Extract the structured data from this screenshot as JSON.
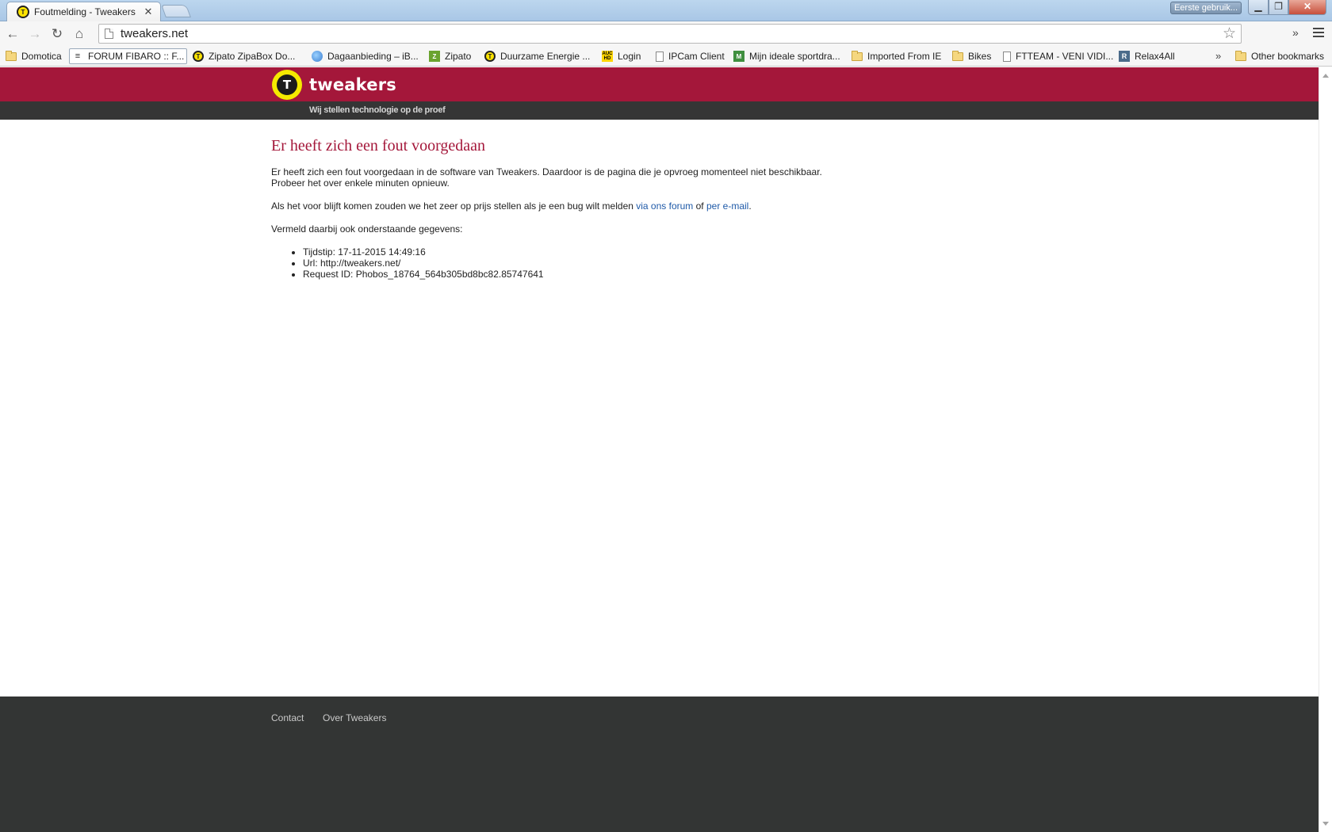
{
  "browser": {
    "tab_title": "Foutmelding - Tweakers",
    "tab_close_glyph": "✕",
    "profile_button": "Eerste gebruik...",
    "window_min": "▁",
    "window_max": "❐",
    "window_close": "✕",
    "url": "tweakers.net",
    "bookmarks_overflow": "»",
    "bookmarks": [
      {
        "label": "Domotica",
        "icon": "folder-icon"
      },
      {
        "label": "FORUM FIBARO :: F...",
        "icon": "fibaro-icon"
      },
      {
        "label": "Zipato ZipaBox Do...",
        "icon": "tweakers-icon"
      },
      {
        "label": "Dagaanbieding – iB...",
        "icon": "globe-icon"
      },
      {
        "label": "Zipato",
        "icon": "zipato-icon"
      },
      {
        "label": "Duurzame Energie ...",
        "icon": "tweakers-icon"
      },
      {
        "label": "Login",
        "icon": "auc-hd-icon"
      },
      {
        "label": "IPCam Client",
        "icon": "page-icon"
      },
      {
        "label": "Mijn ideale sportdra...",
        "icon": "sport-icon"
      },
      {
        "label": "Imported From IE",
        "icon": "folder-icon"
      },
      {
        "label": "Bikes",
        "icon": "folder-icon"
      },
      {
        "label": "FTTEAM - VENI VIDI...",
        "icon": "page-icon"
      },
      {
        "label": "Relax4All",
        "icon": "relax-icon"
      },
      {
        "label": "Other bookmarks",
        "icon": "folder-icon"
      }
    ]
  },
  "site": {
    "logo_text": "tweakers",
    "logo_mark": "T",
    "tagline": "Wij stellen technologie op de proef",
    "brand_color": "#a4173a"
  },
  "error": {
    "title": "Er heeft zich een fout voorgedaan",
    "line1": "Er heeft zich een fout voorgedaan in de software van Tweakers. Daardoor is de pagina die je opvroeg momenteel niet beschikbaar.",
    "line2": "Probeer het over enkele minuten opnieuw.",
    "report_prefix": "Als het voor blijft komen zouden we het zeer op prijs stellen als je een bug wilt melden ",
    "report_link_forum": "via ons forum",
    "report_or": " of ",
    "report_link_email": "per e-mail",
    "report_suffix": ".",
    "details_intro": "Vermeld daarbij ook onderstaande gegevens:",
    "details": [
      "Tijdstip: 17-11-2015 14:49:16",
      "Url: http://tweakers.net/",
      "Request ID: Phobos_18764_564b305bd8bc82.85747641"
    ]
  },
  "footer": {
    "contact": "Contact",
    "about": "Over Tweakers"
  }
}
